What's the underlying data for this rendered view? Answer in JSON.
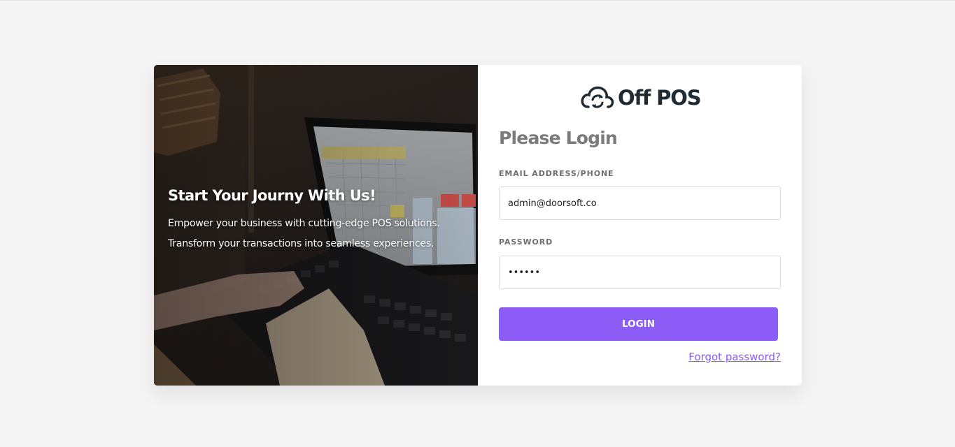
{
  "hero": {
    "title": "Start Your Journy With Us!",
    "line1": "Empower your business with cutting-edge POS solutions.",
    "line2": "Transform your transactions into seamless experiences."
  },
  "logo": {
    "text": "Off POS",
    "icon": "cloud-sync-icon"
  },
  "form": {
    "heading": "Please Login",
    "email_label": "EMAIL ADDRESS/PHONE",
    "email_value": "admin@doorsoft.co",
    "password_label": "PASSWORD",
    "password_value": "123456",
    "login_label": "LOGIN",
    "forgot_label": "Forgot password?"
  },
  "colors": {
    "accent": "#8b5cf6",
    "background": "#f4f4f4",
    "heading": "#7b7b7b",
    "logo": "#1f2a33"
  }
}
